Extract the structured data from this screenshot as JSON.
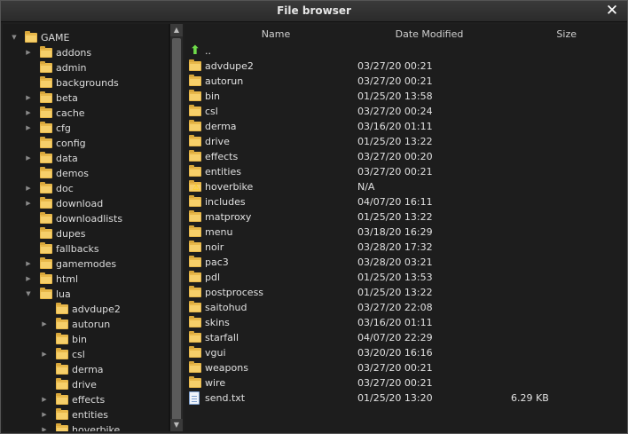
{
  "window": {
    "title": "File browser"
  },
  "tree": {
    "root": "GAME",
    "items": [
      {
        "label": "addons",
        "arrow": true,
        "depth": 1
      },
      {
        "label": "admin",
        "arrow": false,
        "depth": 1
      },
      {
        "label": "backgrounds",
        "arrow": false,
        "depth": 1
      },
      {
        "label": "beta",
        "arrow": true,
        "depth": 1
      },
      {
        "label": "cache",
        "arrow": true,
        "depth": 1
      },
      {
        "label": "cfg",
        "arrow": true,
        "depth": 1
      },
      {
        "label": "config",
        "arrow": false,
        "depth": 1
      },
      {
        "label": "data",
        "arrow": true,
        "depth": 1
      },
      {
        "label": "demos",
        "arrow": false,
        "depth": 1
      },
      {
        "label": "doc",
        "arrow": true,
        "depth": 1
      },
      {
        "label": "download",
        "arrow": true,
        "depth": 1
      },
      {
        "label": "downloadlists",
        "arrow": false,
        "depth": 1
      },
      {
        "label": "dupes",
        "arrow": false,
        "depth": 1
      },
      {
        "label": "fallbacks",
        "arrow": false,
        "depth": 1
      },
      {
        "label": "gamemodes",
        "arrow": true,
        "depth": 1
      },
      {
        "label": "html",
        "arrow": true,
        "depth": 1
      },
      {
        "label": "lua",
        "arrow": true,
        "expanded": true,
        "depth": 1
      },
      {
        "label": "advdupe2",
        "arrow": false,
        "depth": 2
      },
      {
        "label": "autorun",
        "arrow": true,
        "depth": 2
      },
      {
        "label": "bin",
        "arrow": false,
        "depth": 2
      },
      {
        "label": "csl",
        "arrow": true,
        "depth": 2
      },
      {
        "label": "derma",
        "arrow": false,
        "depth": 2
      },
      {
        "label": "drive",
        "arrow": false,
        "depth": 2
      },
      {
        "label": "effects",
        "arrow": true,
        "depth": 2
      },
      {
        "label": "entities",
        "arrow": true,
        "depth": 2
      },
      {
        "label": "hoverbike",
        "arrow": true,
        "depth": 2
      }
    ]
  },
  "list": {
    "columns": {
      "name": "Name",
      "date": "Date Modified",
      "size": "Size"
    },
    "parent": "..",
    "rows": [
      {
        "name": "advdupe2",
        "date": "03/27/20 00:21",
        "size": "",
        "icon": "folder-icon"
      },
      {
        "name": "autorun",
        "date": "03/27/20 00:21",
        "size": "",
        "icon": "folder-icon"
      },
      {
        "name": "bin",
        "date": "01/25/20 13:58",
        "size": "",
        "icon": "folder-icon"
      },
      {
        "name": "csl",
        "date": "03/27/20 00:24",
        "size": "",
        "icon": "folder-icon"
      },
      {
        "name": "derma",
        "date": "03/16/20 01:11",
        "size": "",
        "icon": "folder-icon"
      },
      {
        "name": "drive",
        "date": "01/25/20 13:22",
        "size": "",
        "icon": "folder-icon"
      },
      {
        "name": "effects",
        "date": "03/27/20 00:20",
        "size": "",
        "icon": "folder-icon"
      },
      {
        "name": "entities",
        "date": "03/27/20 00:21",
        "size": "",
        "icon": "folder-icon"
      },
      {
        "name": "hoverbike",
        "date": "N/A",
        "size": "",
        "icon": "folder-warning-icon"
      },
      {
        "name": "includes",
        "date": "04/07/20 16:11",
        "size": "",
        "icon": "folder-icon"
      },
      {
        "name": "matproxy",
        "date": "01/25/20 13:22",
        "size": "",
        "icon": "folder-icon"
      },
      {
        "name": "menu",
        "date": "03/18/20 16:29",
        "size": "",
        "icon": "folder-icon"
      },
      {
        "name": "noir",
        "date": "03/28/20 17:32",
        "size": "",
        "icon": "folder-icon"
      },
      {
        "name": "pac3",
        "date": "03/28/20 03:21",
        "size": "",
        "icon": "folder-icon"
      },
      {
        "name": "pdl",
        "date": "01/25/20 13:53",
        "size": "",
        "icon": "folder-icon"
      },
      {
        "name": "postprocess",
        "date": "01/25/20 13:22",
        "size": "",
        "icon": "folder-icon"
      },
      {
        "name": "saitohud",
        "date": "03/27/20 22:08",
        "size": "",
        "icon": "folder-icon"
      },
      {
        "name": "skins",
        "date": "03/16/20 01:11",
        "size": "",
        "icon": "folder-icon"
      },
      {
        "name": "starfall",
        "date": "04/07/20 22:29",
        "size": "",
        "icon": "folder-icon"
      },
      {
        "name": "vgui",
        "date": "03/20/20 16:16",
        "size": "",
        "icon": "folder-icon"
      },
      {
        "name": "weapons",
        "date": "03/27/20 00:21",
        "size": "",
        "icon": "folder-icon"
      },
      {
        "name": "wire",
        "date": "03/27/20 00:21",
        "size": "",
        "icon": "folder-icon"
      },
      {
        "name": "send.txt",
        "date": "01/25/20 13:20",
        "size": "6.29 KB",
        "icon": "text-file-icon"
      }
    ]
  },
  "colors": {
    "folder": "#e8b84a",
    "background": "#1f1f1f",
    "titlebar": "#333333"
  }
}
